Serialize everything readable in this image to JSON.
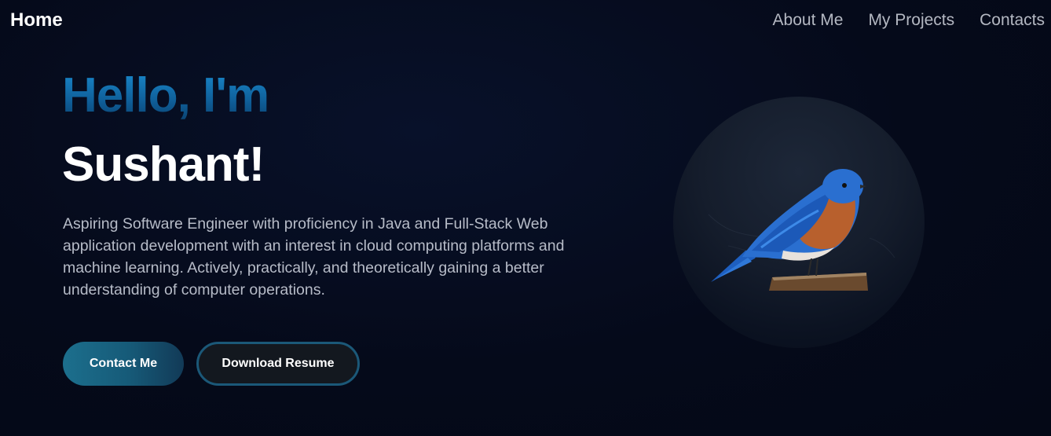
{
  "nav": {
    "home": "Home",
    "links": [
      "About Me",
      "My Projects",
      "Contacts"
    ]
  },
  "hero": {
    "greeting": "Hello, I'm",
    "name": "Sushant!",
    "description": "Aspiring Software Engineer with proficiency in Java and Full-Stack Web application development with an interest in cloud computing platforms and machine learning. Actively, practically, and theoretically gaining a better understanding of computer operations.",
    "buttons": {
      "contact": "Contact Me",
      "resume": "Download Resume"
    }
  },
  "avatar": {
    "icon": "bluebird-icon"
  },
  "colors": {
    "background": "#050a18",
    "greeting_gradient_top": "#1a8cd0",
    "greeting_gradient_bottom": "#0a3f6c",
    "accent": "#1c6f8d",
    "resume_border": "#1b5878"
  }
}
